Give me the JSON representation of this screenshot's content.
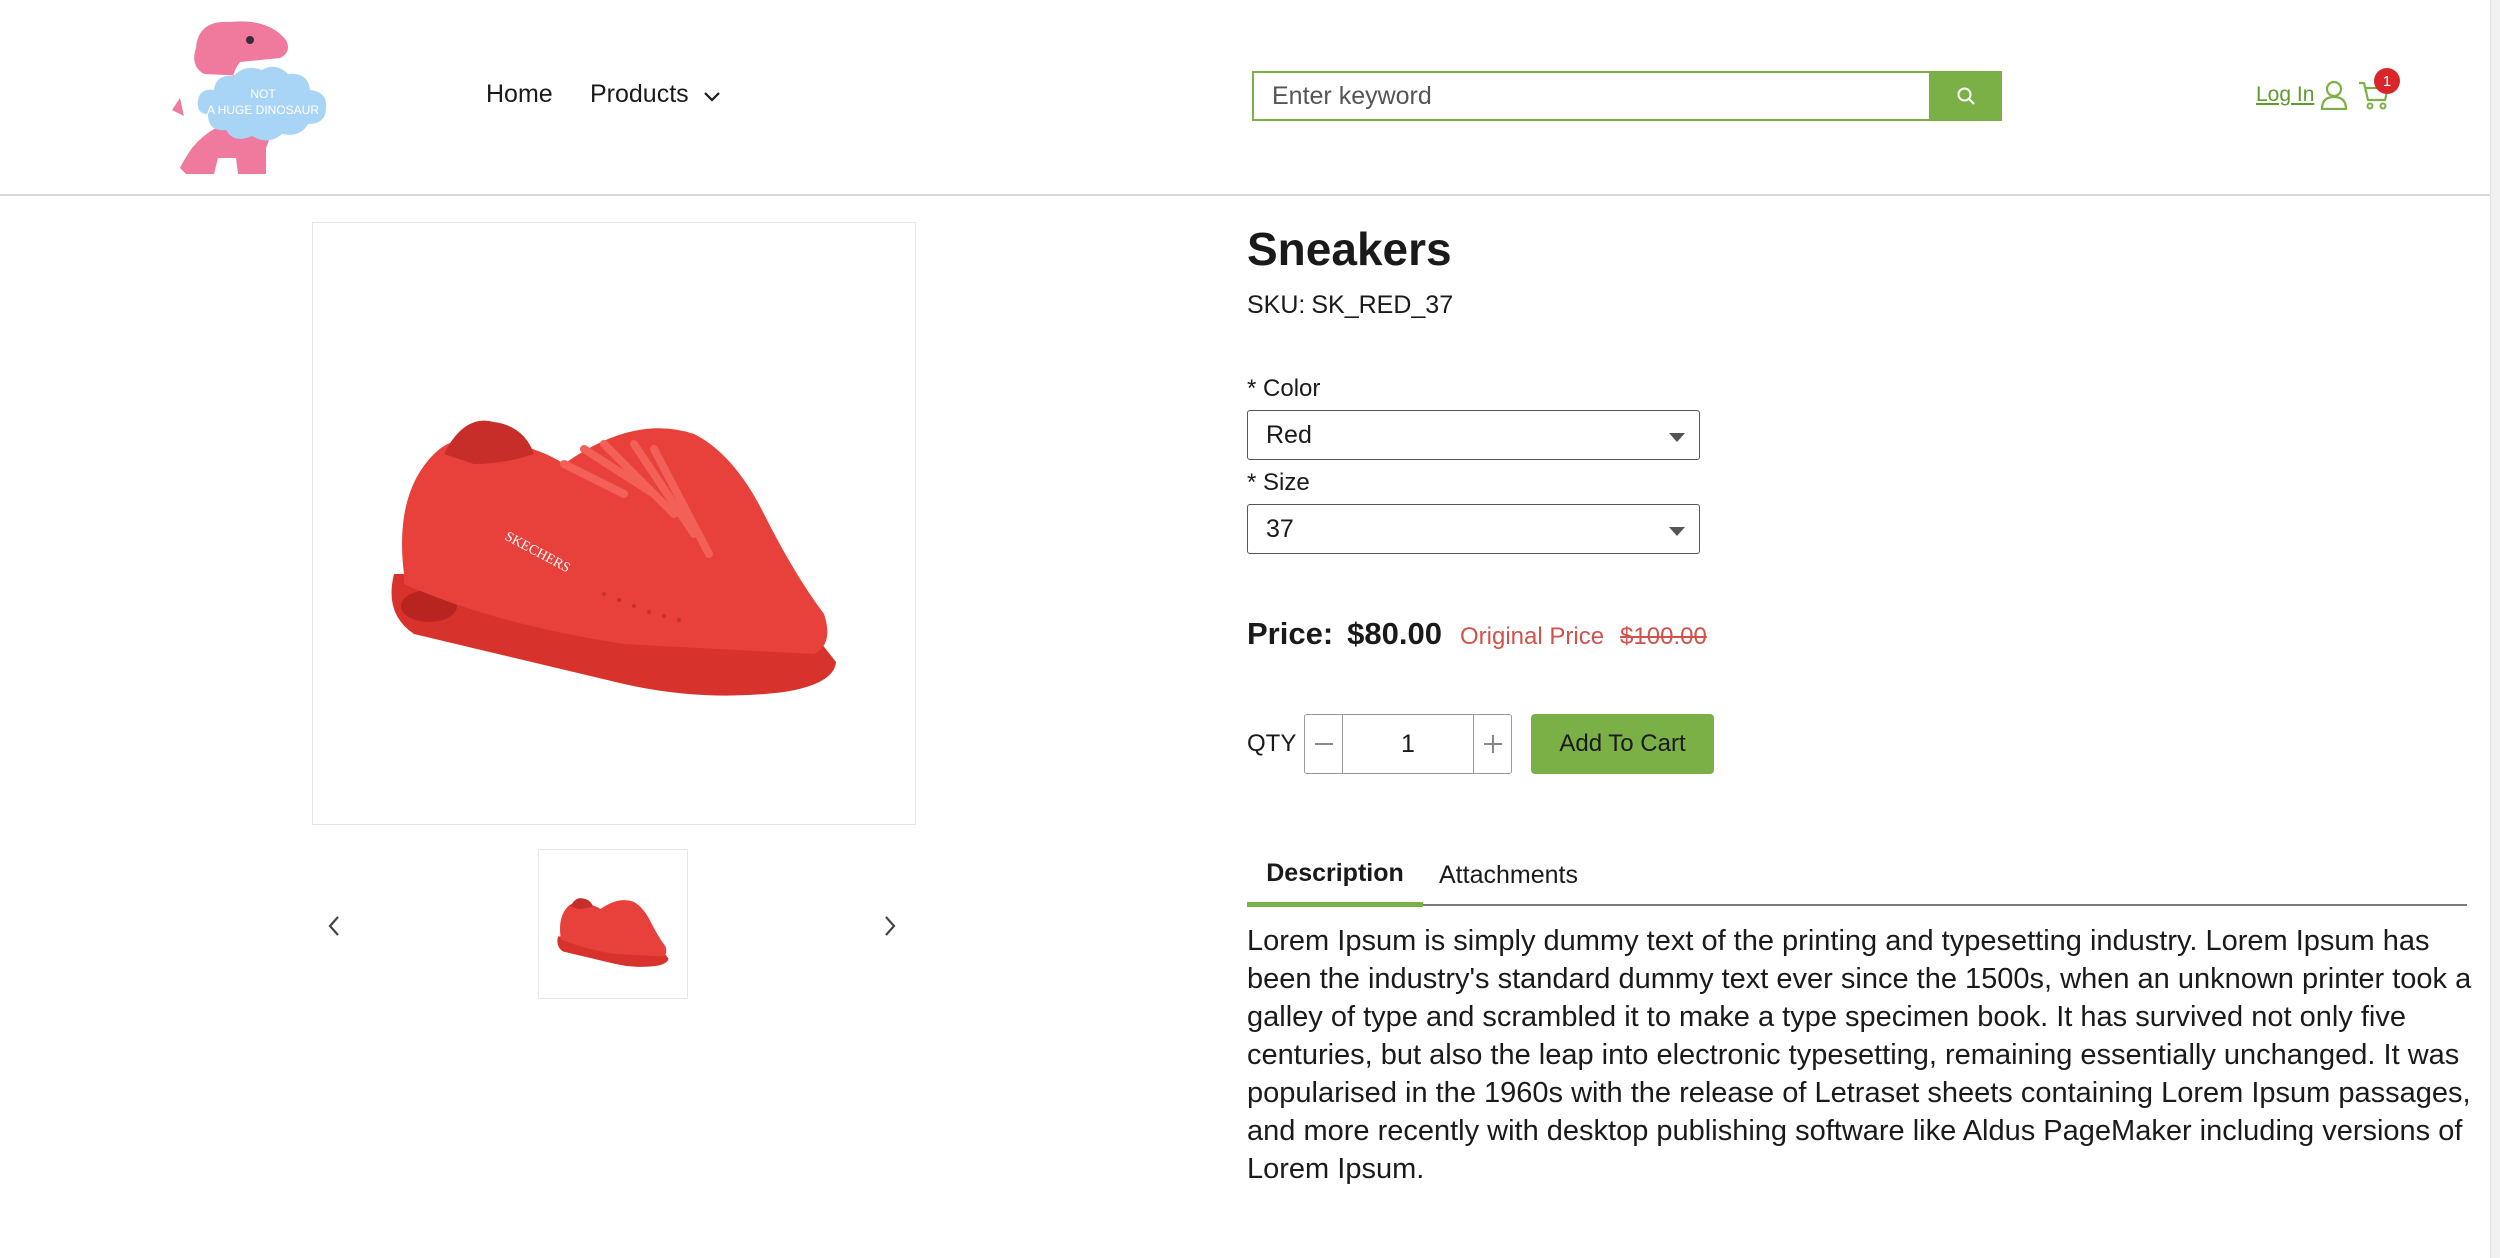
{
  "header": {
    "logo_text_line1": "NOT",
    "logo_text_line2": "A HUGE DINOSAUR",
    "nav": {
      "home": "Home",
      "products": "Products"
    },
    "search": {
      "placeholder": "Enter keyword",
      "value": ""
    },
    "login": "Log In",
    "cart_count": "1"
  },
  "product": {
    "title": "Sneakers",
    "sku_label": "SKU:",
    "sku_value": "SK_RED_37",
    "color_label": "* Color",
    "color_value": "Red",
    "size_label": "* Size",
    "size_value": "37",
    "price_label": "Price:",
    "price_value": "$80.00",
    "original_price_label": "Original Price",
    "original_price_value": "$100.00",
    "qty_label": "QTY",
    "qty_value": "1",
    "add_to_cart": "Add To Cart",
    "shoe_brand_text": "SKECHERS"
  },
  "tabs": {
    "description": "Description",
    "attachments": "Attachments"
  },
  "description_text": "Lorem Ipsum is simply dummy text of the printing and typesetting industry. Lorem Ipsum has been the industry's standard dummy text ever since the 1500s, when an unknown printer took a galley of type and scrambled it to make a type specimen book. It has survived not only five centuries, but also the leap into electronic typesetting, remaining essentially unchanged. It was popularised in the 1960s with the release of Letraset sheets containing Lorem Ipsum passages, and more recently with desktop publishing software like Aldus PageMaker including versions of Lorem Ipsum.",
  "colors": {
    "accent": "#7bb046",
    "sale": "#d0524a",
    "badge": "#d9262a",
    "logo_pink": "#ef7a9e",
    "logo_blue": "#a8d4f5",
    "shoe_red": "#e8403a"
  },
  "icons": [
    "dinosaur-logo",
    "chevron-down-icon",
    "search-icon",
    "user-icon",
    "cart-icon",
    "chevron-left-icon",
    "chevron-right-icon",
    "minus-icon",
    "plus-icon"
  ]
}
